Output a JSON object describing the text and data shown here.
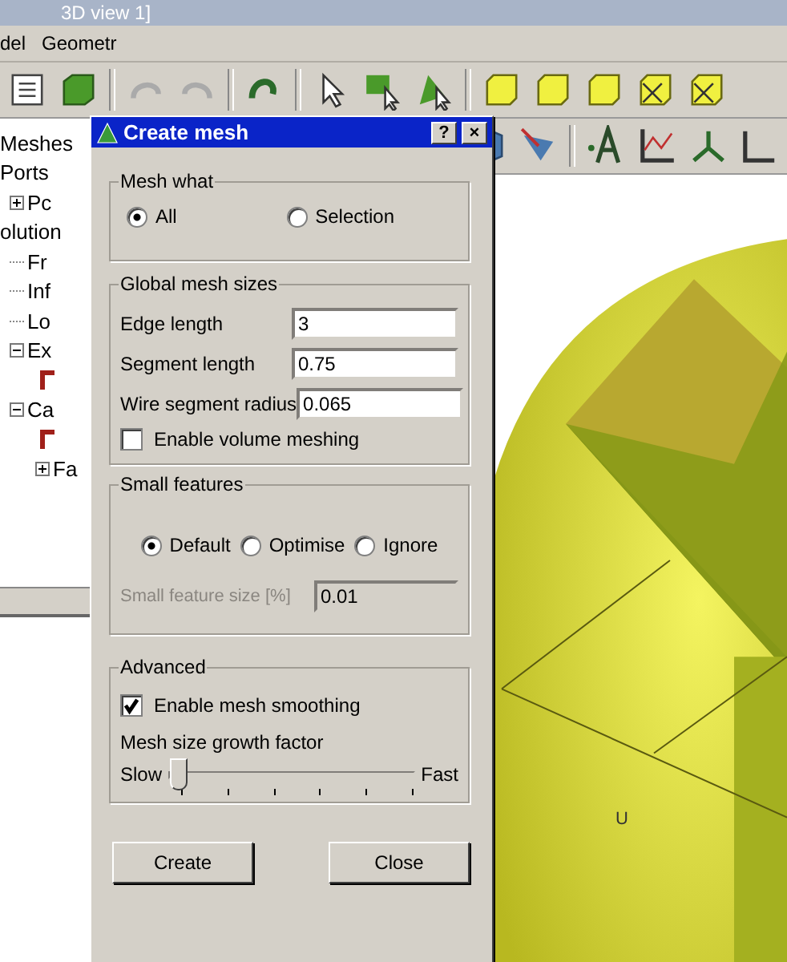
{
  "window": {
    "title": "3D view 1]"
  },
  "menu": [
    "del",
    "Geometr"
  ],
  "tree": [
    {
      "label": "Meshes"
    },
    {
      "label": "Ports",
      "children": [
        {
          "label": "Pc",
          "expanded": false
        }
      ]
    },
    {
      "label": "olution",
      "children": [
        {
          "label": "Fr"
        },
        {
          "label": "Inf"
        },
        {
          "label": "Lo"
        },
        {
          "label": "Ex",
          "expanded": true
        },
        {
          "label": "Ca",
          "expanded": true,
          "children": [
            {
              "label": "Fa",
              "expanded": false
            }
          ]
        }
      ]
    }
  ],
  "dialog": {
    "title": "Create mesh",
    "help": "?",
    "close": "×",
    "mesh_what": {
      "title": "Mesh what",
      "options": [
        {
          "label": "All",
          "selected": true
        },
        {
          "label": "Selection",
          "selected": false
        }
      ]
    },
    "global": {
      "title": "Global mesh sizes",
      "fields": [
        {
          "label": "Edge length",
          "value": "3"
        },
        {
          "label": "Segment length",
          "value": "0.75"
        },
        {
          "label": "Wire segment radius",
          "value": "0.065"
        }
      ],
      "volume": {
        "label": "Enable volume meshing",
        "checked": false
      }
    },
    "small": {
      "title": "Small features",
      "options": [
        {
          "label": "Default",
          "selected": true
        },
        {
          "label": "Optimise",
          "selected": false
        },
        {
          "label": "Ignore",
          "selected": false
        }
      ],
      "size": {
        "label": "Small feature size [%]",
        "value": "0.01",
        "disabled": true
      }
    },
    "advanced": {
      "title": "Advanced",
      "smoothing": {
        "label": "Enable mesh smoothing",
        "checked": true
      },
      "growth": {
        "label": "Mesh size growth factor",
        "min": "Slow",
        "max": "Fast",
        "level": 0
      }
    },
    "buttons": [
      "Create",
      "Close"
    ]
  },
  "view": {
    "axis_label": "U"
  }
}
